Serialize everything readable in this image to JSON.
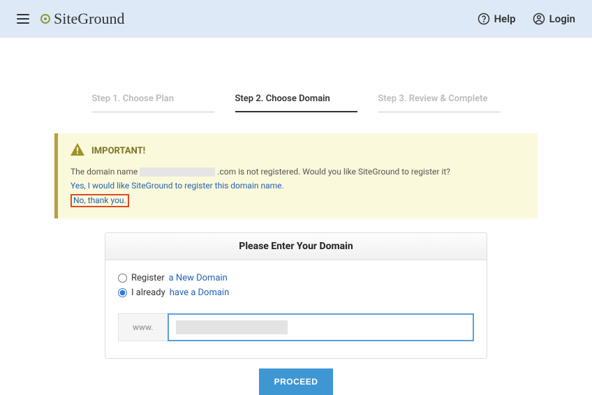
{
  "header": {
    "brand": "SiteGround",
    "help_label": "Help",
    "login_label": "Login"
  },
  "steps": [
    "Step 1. Choose Plan",
    "Step 2. Choose Domain",
    "Step 3. Review & Complete"
  ],
  "alert": {
    "title": "IMPORTANT!",
    "text_before": "The domain name ",
    "text_after": ".com is not registered. Would you like SiteGround to register it?",
    "link_yes": "Yes, I would like SiteGround to register this domain name.",
    "link_no": "No, thank you."
  },
  "domain_panel": {
    "title": "Please Enter Your Domain",
    "option_register_prefix": "Register ",
    "option_register_link": "a New Domain",
    "option_have_prefix": "I already ",
    "option_have_link": "have a Domain",
    "input_prefix": "www.",
    "input_value": ""
  },
  "proceed_label": "PROCEED"
}
